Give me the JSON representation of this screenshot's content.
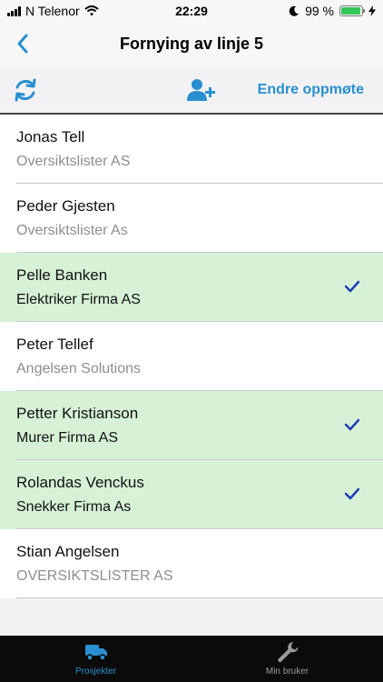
{
  "status_bar": {
    "carrier": "N Telenor",
    "time": "22:29",
    "battery": "99 %",
    "icons": [
      "signal-icon",
      "wifi-icon",
      "moon-icon",
      "battery-icon",
      "charging-icon"
    ]
  },
  "nav": {
    "title": "Fornying av linje 5",
    "back_icon": "chevron-left-icon"
  },
  "toolbar": {
    "refresh_icon": "refresh-icon",
    "add_user_icon": "add-user-icon",
    "edit_attendance_label": "Endre oppmøte"
  },
  "attendees": [
    {
      "name": "Jonas Tell",
      "company": "Oversiktslister AS",
      "selected": false
    },
    {
      "name": "Peder Gjesten",
      "company": "Oversiktslister As",
      "selected": false
    },
    {
      "name": "Pelle Banken",
      "company": "Elektriker Firma AS",
      "selected": true
    },
    {
      "name": "Peter Tellef",
      "company": "Angelsen Solutions",
      "selected": false
    },
    {
      "name": "Petter Kristianson",
      "company": "Murer Firma AS",
      "selected": true
    },
    {
      "name": "Rolandas Venckus",
      "company": "Snekker Firma As",
      "selected": true
    },
    {
      "name": "Stian Angelsen",
      "company": "OVERSIKTSLISTER AS",
      "selected": false
    }
  ],
  "tabs": {
    "projects": {
      "label": "Prosjekter",
      "icon": "truck-icon",
      "active": true
    },
    "my_user": {
      "label": "Min bruker",
      "icon": "wrench-icon",
      "active": false
    }
  },
  "colors": {
    "accent": "#2a8fd0",
    "selected_row": "#d6f1d6",
    "check": "#1f3fb5",
    "tab_bar": "#0b0b0b"
  }
}
